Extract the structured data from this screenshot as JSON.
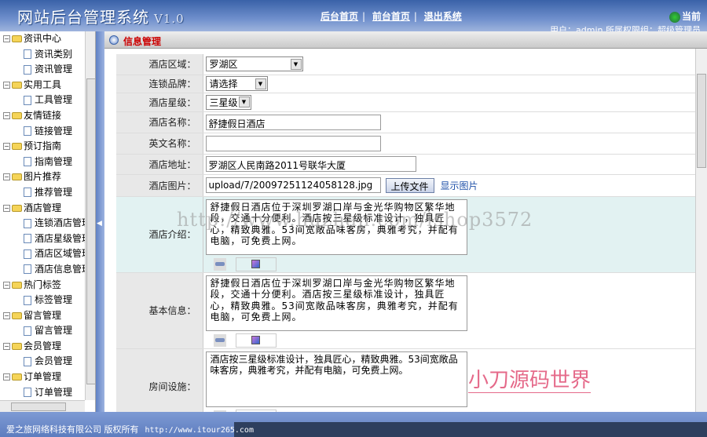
{
  "header": {
    "title": "网站后台管理系统",
    "version": "V1.0",
    "nav": [
      "后台首页",
      "前台首页",
      "退出系统"
    ],
    "current_label": "当前",
    "user_info": "用户：admin  所属权限组：超级管理员"
  },
  "sidebar": {
    "groups": [
      {
        "label": "资讯中心",
        "items": [
          "资讯类别",
          "资讯管理"
        ]
      },
      {
        "label": "实用工具",
        "items": [
          "工具管理"
        ]
      },
      {
        "label": "友情链接",
        "items": [
          "链接管理"
        ]
      },
      {
        "label": "预订指南",
        "items": [
          "指南管理"
        ]
      },
      {
        "label": "图片推荐",
        "items": [
          "推荐管理"
        ]
      },
      {
        "label": "酒店管理",
        "items": [
          "连锁酒店管理",
          "酒店星级管理",
          "酒店区域管理",
          "酒店信息管理"
        ]
      },
      {
        "label": "热门标签",
        "items": [
          "标签管理"
        ]
      },
      {
        "label": "留言管理",
        "items": [
          "留言管理"
        ]
      },
      {
        "label": "会员管理",
        "items": [
          "会员管理"
        ]
      },
      {
        "label": "订单管理",
        "items": [
          "订单管理"
        ]
      }
    ]
  },
  "panel": {
    "title": "信息管理"
  },
  "form": {
    "region": {
      "label": "酒店区域：",
      "value": "罗湖区"
    },
    "brand": {
      "label": "连锁品牌：",
      "value": "请选择"
    },
    "star": {
      "label": "酒店星级：",
      "value": "三星级"
    },
    "name": {
      "label": "酒店名称：",
      "value": "舒捷假日酒店"
    },
    "en_name": {
      "label": "英文名称：",
      "value": ""
    },
    "address": {
      "label": "酒店地址：",
      "value": "罗湖区人民南路2011号联华大厦"
    },
    "image": {
      "label": "酒店图片：",
      "value": "upload/7/20097251124058128.jpg",
      "upload_label": "上传文件",
      "show_label": "显示图片"
    },
    "intro": {
      "label": "酒店介绍：",
      "value": "舒捷假日酒店位于深圳罗湖口岸与金光华购物区繁华地段，交通十分便利。酒店按三星级标准设计，独具匠心，精致典雅。53间宽敞品味客房，典雅考究，并配有电脑，可免费上网。"
    },
    "basic": {
      "label": "基本信息：",
      "value": "舒捷假日酒店位于深圳罗湖口岸与金光华购物区繁华地段，交通十分便利。酒店按三星级标准设计，独具匠心，精致典雅。53间宽敞品味客房，典雅考究，并配有电脑，可免费上网。"
    },
    "rooms": {
      "label": "房间设施：",
      "value": "酒店按三星级标准设计，独具匠心，精致典雅。53间宽敞品味客房，典雅考究，并配有电脑，可免费上网。"
    }
  },
  "watermark": "http://www.huzhan.com/ishop3572",
  "stamp": "小刀源码世界",
  "footer": {
    "company": "爱之旅网络科技有限公司  版权所有",
    "url": "http://www.itour265.com"
  }
}
